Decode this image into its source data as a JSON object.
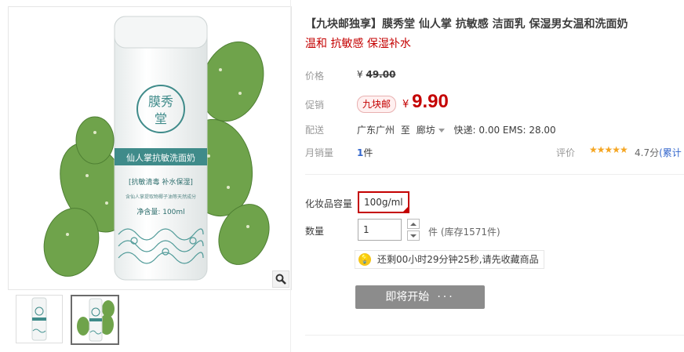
{
  "product": {
    "title": "【九块邮独享】膜秀堂 仙人掌 抗敏感 洁面乳 保湿男女温和洗面奶",
    "subtitle": "温和 抗敏感 保湿补水"
  },
  "price": {
    "label": "价格",
    "currency": "¥",
    "original": "49.00"
  },
  "promotion": {
    "label": "促销",
    "tag": "九块邮",
    "currency": "¥",
    "price": "9.90"
  },
  "shipping": {
    "label": "配送",
    "from": "广东广州",
    "to_word": "至",
    "destination": "廊坊",
    "fees": "快递: 0.00 EMS: 28.00"
  },
  "sales": {
    "label": "月销量",
    "count": "1",
    "unit": "件"
  },
  "rating": {
    "label": "评价",
    "stars": "★★★★★",
    "score": "4.7分",
    "cumulative": "(累计"
  },
  "spec": {
    "label": "化妆品容量",
    "selected": "100g/ml"
  },
  "quantity": {
    "label": "数量",
    "value": "1",
    "unit_stock": "件 (库存1571件)"
  },
  "reminder": {
    "icon": "lightbulb-icon",
    "text": "还剩00小时29分钟25秒,请先收藏商品"
  },
  "buy_button": {
    "label": "即将开始",
    "dots": "···"
  },
  "bottle": {
    "brand_logo": "膜秀堂",
    "product_name": "仙人掌抗敏洗面奶",
    "tagline": "[抗敏清毒 补水保湿]",
    "ingredients": "含仙人掌提取物椰子油等天然成分",
    "volume": "净含量: 100ml"
  },
  "colors": {
    "accent_red": "#c40000",
    "link_blue": "#3366cc",
    "teal_brand": "#3f8b8a",
    "button_gray": "#8c8c8c"
  }
}
